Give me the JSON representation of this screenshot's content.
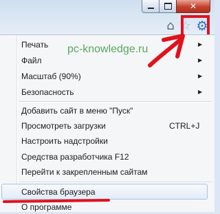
{
  "window_controls": {
    "minimize_icon": "minimize-icon",
    "maximize_icon": "maximize-icon",
    "close_glyph": "✕"
  },
  "toolbar": {
    "home_icon": "home-icon",
    "favorites_icon": "star-icon",
    "tools_icon": "gear-icon"
  },
  "watermark": "pc-knowledge.ru",
  "menu": {
    "items": [
      {
        "label": "Печать",
        "submenu": true
      },
      {
        "label": "Файл",
        "submenu": true
      },
      {
        "label": "Масштаб (90%)",
        "submenu": true
      },
      {
        "label": "Безопасность",
        "submenu": true
      },
      {
        "label": "Добавить сайт в меню \"Пуск\""
      },
      {
        "label": "Просмотреть загрузки",
        "shortcut": "CTRL+J"
      },
      {
        "label": "Настроить надстройки"
      },
      {
        "label": "Средства разработчика F12"
      },
      {
        "label": "Перейти к закрепленным сайтам"
      },
      {
        "label": "Свойства браузера",
        "highlighted": true
      },
      {
        "label": "О программе"
      }
    ]
  },
  "annotation_color": "#e0121c"
}
